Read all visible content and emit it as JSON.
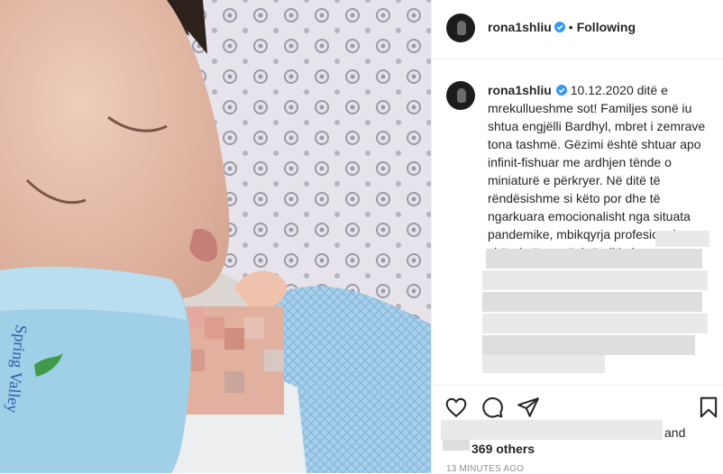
{
  "post": {
    "image_alt": "Mother sleeping with newborn baby",
    "bottle_label": "Spring Valley"
  },
  "header": {
    "username": "rona1shliu",
    "separator": "•",
    "follow_label": "Following",
    "icons": {
      "avatar": "avatar",
      "verified": "verified-badge-icon"
    }
  },
  "caption": {
    "username": "rona1shliu",
    "text": "10.12.2020 ditë e mrekullueshme sot! Familjes sonë iu shtua engjëlli Bardhyl, mbret i zemrave tona tashmë. Gëzimi është shtuar apo infinit-fishuar me ardhjen tënde o miniaturë e përkryer. Në ditë të rëndësishme si këto por dhe të ngarkuara emocionalisht nga situata pandemike, mbikqyrja profesionale shëndetësore është gjithçka."
  },
  "actions": {
    "icons": [
      "heart-icon",
      "comment-icon",
      "share-icon",
      "bookmark-icon"
    ]
  },
  "likes": {
    "and_text": "and",
    "others_text": "369 others"
  },
  "timestamp": "13 MINUTES AGO",
  "colors": {
    "verified": "#3897f0",
    "text": "#262626",
    "muted": "#8e8e8e",
    "border": "#efefef"
  }
}
